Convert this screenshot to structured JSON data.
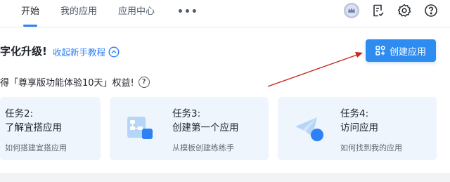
{
  "nav": {
    "tabs": [
      {
        "label": "开始",
        "active": true
      },
      {
        "label": "我的应用",
        "active": false
      },
      {
        "label": "应用中心",
        "active": false
      }
    ],
    "more_label": "•••",
    "icons": [
      "crown-badge-icon",
      "task-list-icon",
      "gear-icon",
      "help-icon"
    ]
  },
  "headline": {
    "title": "字化升级!",
    "collapse_link": "收起新手教程"
  },
  "create_button": {
    "label": "创建应用",
    "icon": "app-grid-icon"
  },
  "promo": {
    "text": "得「尊享版功能体验10天」权益!",
    "help": "?"
  },
  "tasks": [
    {
      "number": "任务2:",
      "title": "了解宜搭应用",
      "desc": "如何搭建宜搭应用",
      "icon": ""
    },
    {
      "number": "任务3:",
      "title": "创建第一个应用",
      "desc": "从模板创建练练手",
      "icon": "flowchart-icon"
    },
    {
      "number": "任务4:",
      "title": "访问应用",
      "desc": "如何找到我的应用",
      "icon": "paper-plane-icon"
    }
  ],
  "colors": {
    "accent": "#2e8bf0",
    "link": "#2e80f5",
    "card_bg": "#eef5fd",
    "arrow": "#c8261e"
  }
}
